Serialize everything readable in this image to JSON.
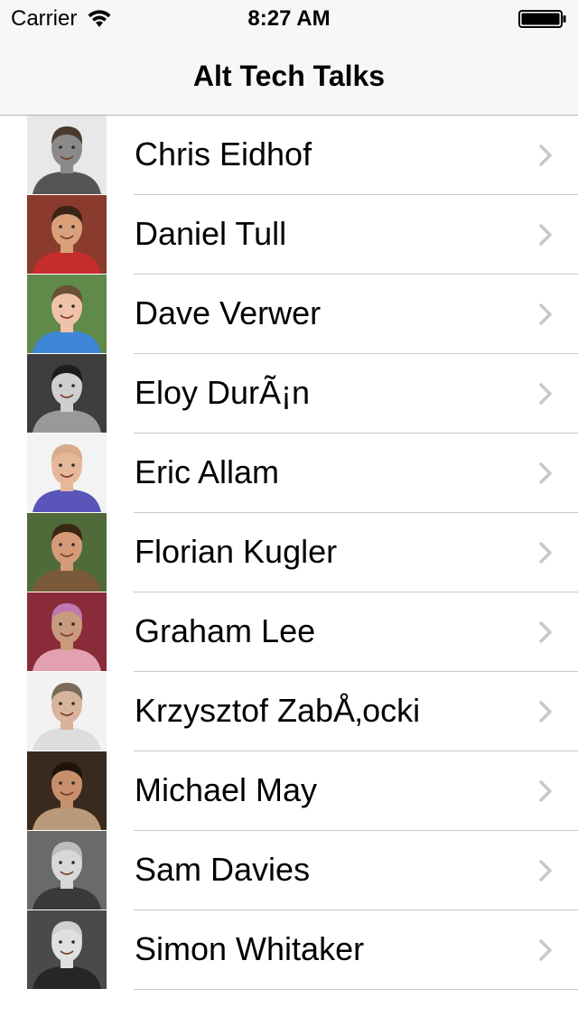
{
  "status_bar": {
    "carrier": "Carrier",
    "time": "8:27 AM",
    "wifi_icon": "wifi-icon",
    "battery_icon": "battery-icon"
  },
  "nav": {
    "title": "Alt Tech Talks"
  },
  "speakers": [
    {
      "name": "Chris Eidhof",
      "photo_tone": "#8a8a8a",
      "bg": "#e8e8e8",
      "shirt": "#555555",
      "hair": "#4a3a2a"
    },
    {
      "name": "Daniel Tull",
      "photo_tone": "#d9a07a",
      "bg": "#8a3b2e",
      "shirt": "#c62d2d",
      "hair": "#3a2414"
    },
    {
      "name": "Dave Verwer",
      "photo_tone": "#f0c2a8",
      "bg": "#5f8a4a",
      "shirt": "#3f86d6",
      "hair": "#6a5038"
    },
    {
      "name": "Eloy DurÃ¡n",
      "photo_tone": "#cfcfcf",
      "bg": "#3d3d3d",
      "shirt": "#999999",
      "hair": "#1c1c1c"
    },
    {
      "name": "Eric Allam",
      "photo_tone": "#e6b89a",
      "bg": "#f3f3f3",
      "shirt": "#5a55b8",
      "hair": "#d8a98a"
    },
    {
      "name": "Florian Kugler",
      "photo_tone": "#d59b76",
      "bg": "#4f6b3a",
      "shirt": "#7a5a3a",
      "hair": "#3b2716"
    },
    {
      "name": "Graham Lee",
      "photo_tone": "#c99b7d",
      "bg": "#8a2b3a",
      "shirt": "#e2a0b0",
      "hair": "#c078b0"
    },
    {
      "name": "Krzysztof ZabÅ‚ocki",
      "photo_tone": "#d8b49c",
      "bg": "#f2f2f2",
      "shirt": "#dddddd",
      "hair": "#7a6a5a"
    },
    {
      "name": "Michael May",
      "photo_tone": "#c78f6b",
      "bg": "#3a2a1e",
      "shirt": "#b89a7a",
      "hair": "#1e140c"
    },
    {
      "name": "Sam Davies",
      "photo_tone": "#d8d8d8",
      "bg": "#6a6a6a",
      "shirt": "#3a3a3a",
      "hair": "#bdbdbd"
    },
    {
      "name": "Simon Whitaker",
      "photo_tone": "#e0e0e0",
      "bg": "#4a4a4a",
      "shirt": "#262626",
      "hair": "#cfcfcf"
    }
  ],
  "row_icon": "chevron-right-icon"
}
